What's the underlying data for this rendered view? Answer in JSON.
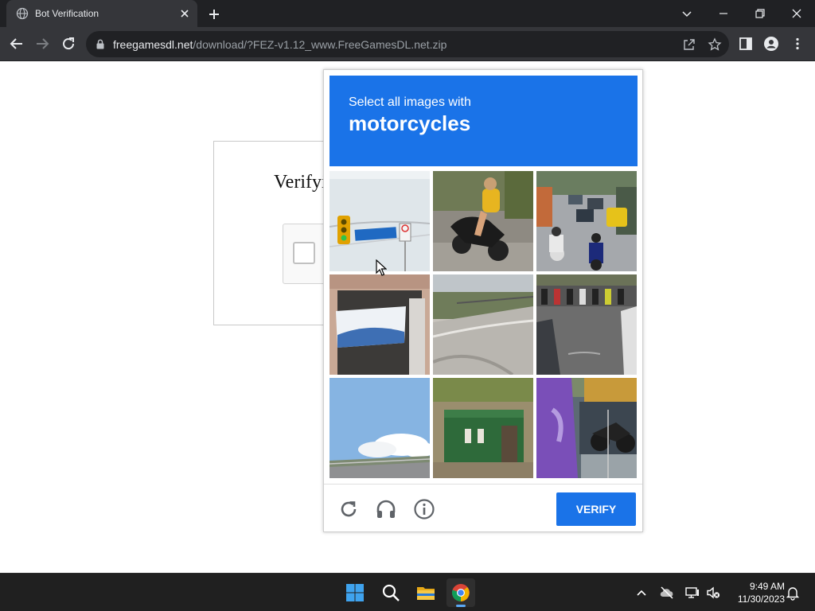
{
  "browser": {
    "tab_title": "Bot Verification",
    "url_host": "freegamesdl.net",
    "url_path": "/download/?FEZ-v1.12_www.FreeGamesDL.net.zip"
  },
  "page": {
    "heading": "Verifying that you are"
  },
  "captcha": {
    "instruction": "Select all images with",
    "target": "motorcycles",
    "verify_label": "VERIFY",
    "accent_color": "#1a73e8",
    "tiles": [
      {
        "id": 1,
        "depicts": "traffic light and street sign"
      },
      {
        "id": 2,
        "depicts": "person riding motorcycle"
      },
      {
        "id": 3,
        "depicts": "street with motorcycles and cars"
      },
      {
        "id": 4,
        "depicts": "building with banner"
      },
      {
        "id": 5,
        "depicts": "road with fence"
      },
      {
        "id": 6,
        "depicts": "parked motorcycles"
      },
      {
        "id": 7,
        "depicts": "sky and highway"
      },
      {
        "id": 8,
        "depicts": "green building"
      },
      {
        "id": 9,
        "depicts": "motorcycle by purple banner"
      }
    ]
  },
  "taskbar": {
    "time": "9:49 AM",
    "date": "11/30/2023"
  }
}
